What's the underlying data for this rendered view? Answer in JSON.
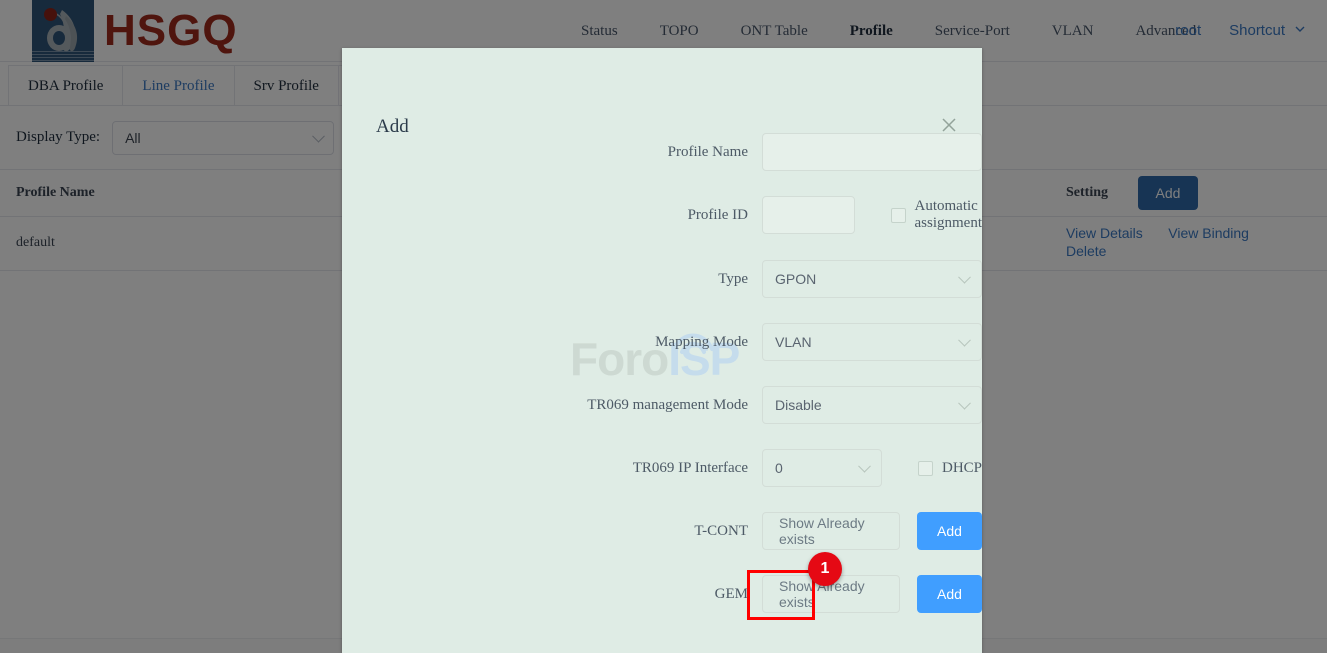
{
  "brand": {
    "name": "HSGQ",
    "logo_icon": "hsgq-flame-logo"
  },
  "nav": {
    "items": [
      {
        "label": "Status",
        "active": false
      },
      {
        "label": "TOPO",
        "active": false
      },
      {
        "label": "ONT Table",
        "active": false
      },
      {
        "label": "Profile",
        "active": true
      },
      {
        "label": "Service-Port",
        "active": false
      },
      {
        "label": "VLAN",
        "active": false
      },
      {
        "label": "Advanced",
        "active": false
      }
    ],
    "user": "root",
    "shortcut": "Shortcut",
    "shortcut_icon": "chevron-down-icon"
  },
  "tabs": [
    {
      "label": "DBA Profile",
      "active": false
    },
    {
      "label": "Line Profile",
      "active": true
    },
    {
      "label": "Srv Profile",
      "active": false
    }
  ],
  "filter": {
    "label": "Display Type:",
    "value": "All",
    "chevron_icon": "chevron-down-icon"
  },
  "table": {
    "columns": [
      "Profile Name",
      "Setting"
    ],
    "header_add_label": "Add",
    "rows": [
      {
        "profile_name": "default",
        "actions": [
          "View Details",
          "View Binding",
          "Delete"
        ]
      }
    ]
  },
  "modal": {
    "title": "Add",
    "close_icon": "close-icon",
    "watermark": {
      "part1": "Foro",
      "part2": "ISP",
      "arc_icon": "wifi-arc-icon"
    },
    "fields": {
      "profile_name": {
        "label": "Profile Name",
        "value": "",
        "placeholder": ""
      },
      "profile_id": {
        "label": "Profile ID",
        "value": "",
        "placeholder": ""
      },
      "automatic_assignment": {
        "label": "Automatic assignment",
        "checked": false
      },
      "type": {
        "label": "Type",
        "value": "GPON",
        "chevron_icon": "chevron-down-icon"
      },
      "mapping_mode": {
        "label": "Mapping Mode",
        "value": "VLAN",
        "chevron_icon": "chevron-down-icon"
      },
      "tr069_management_mode": {
        "label": "TR069 management Mode",
        "value": "Disable",
        "chevron_icon": "chevron-down-icon"
      },
      "tr069_ip_interface": {
        "label": "TR069 IP Interface",
        "value": "0",
        "chevron_icon": "chevron-down-icon"
      },
      "dhcp": {
        "label": "DHCP",
        "checked": false
      },
      "tcont": {
        "label": "T-CONT",
        "show_label": "Show Already exists",
        "add_label": "Add"
      },
      "gem": {
        "label": "GEM",
        "show_label": "Show Already exists",
        "add_label": "Add"
      }
    }
  },
  "annotation": {
    "badge_number": "1",
    "target": "gem-add-button",
    "box_color": "#ff0000",
    "badge_color": "#e50914"
  },
  "colors": {
    "brand_red": "#9e2a1c",
    "logo_navy": "#2f5579",
    "link_blue": "#3a78c3",
    "primary_blue": "#409eff",
    "dark_blue_button": "#2f69a8",
    "modal_bg": "#dfece5"
  }
}
